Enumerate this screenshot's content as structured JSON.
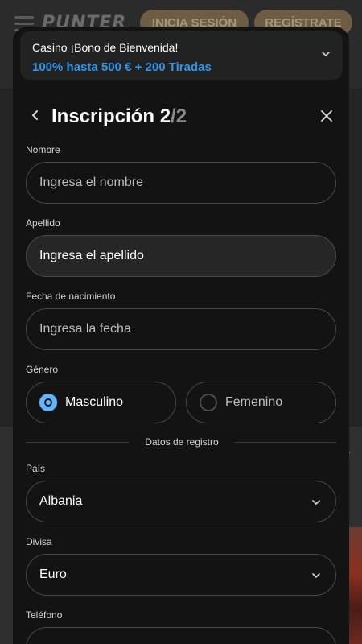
{
  "background": {
    "logo": "PUNTER",
    "login_label": "INICIA SESIÓN",
    "register_label": "REGÍSTRATE"
  },
  "promo": {
    "line1": "Casino ¡Bono de Bienvenida!",
    "line2": "100% hasta 500 € + 200 Tiradas"
  },
  "header": {
    "title": "Inscripción 2",
    "step_separator_total": "/2"
  },
  "form": {
    "first_name": {
      "label": "Nombre",
      "placeholder": "Ingresa el nombre"
    },
    "last_name": {
      "label": "Apellido",
      "placeholder": "Ingresa el apellido"
    },
    "birth_date": {
      "label": "Fecha de nacimiento",
      "placeholder": "Ingresa la fecha"
    },
    "gender": {
      "label": "Género",
      "options": [
        "Masculino",
        "Femenino"
      ],
      "selected": "Masculino"
    },
    "section_divider": "Datos de registro",
    "country": {
      "label": "País",
      "value": "Albania"
    },
    "currency": {
      "label": "Divisa",
      "value": "Euro"
    },
    "phone": {
      "label": "Teléfono"
    }
  },
  "colors": {
    "accent": "#2f95ea",
    "radio_active": "#5eb7ff",
    "modal_bg": "#131313",
    "field_border": "#474747"
  }
}
